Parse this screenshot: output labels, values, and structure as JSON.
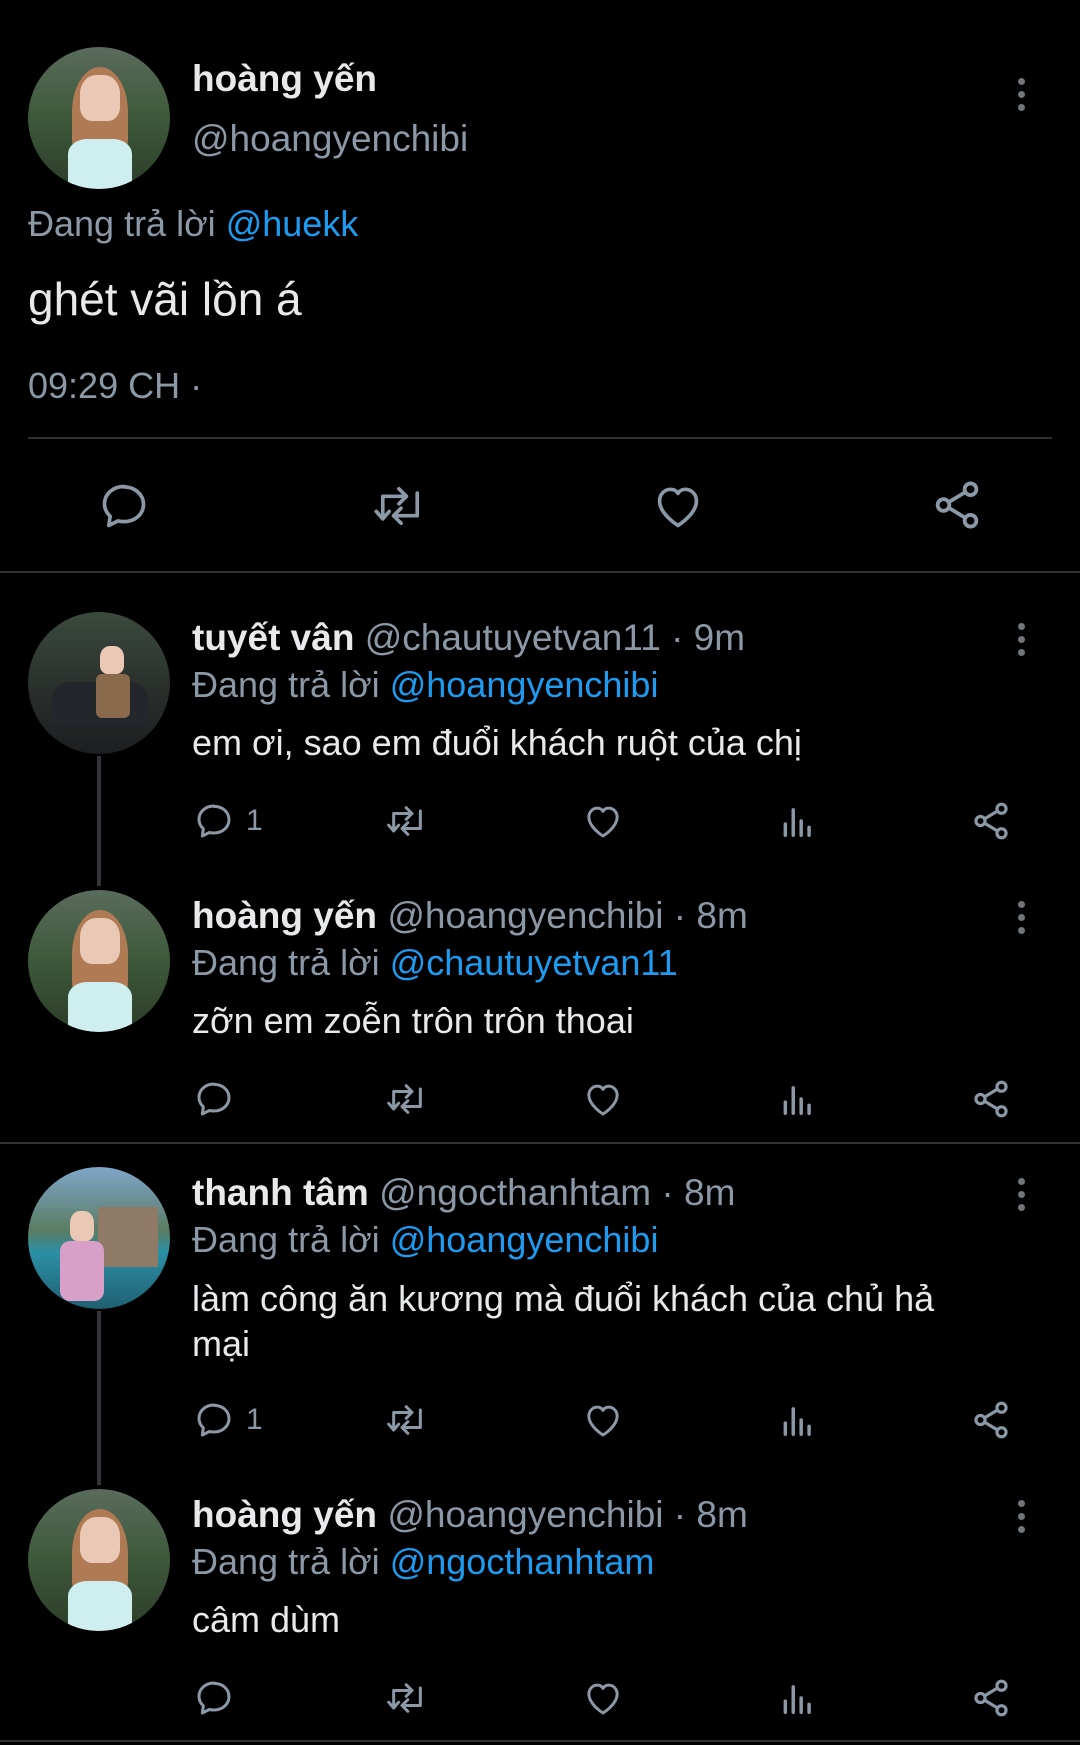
{
  "main_tweet": {
    "display_name": "hoàng yến",
    "handle": "@hoangyenchibi",
    "reply_prefix": "Đang trả lời",
    "reply_to": "@huekk",
    "text": "ghét vãi lồn á",
    "timestamp": "09:29 CH ·"
  },
  "replies": [
    {
      "display_name": "tuyết vân",
      "handle_time": "@chautuyetvan11 · 9m",
      "reply_prefix": "Đang trả lời",
      "reply_to": "@hoangyenchibi",
      "text": "em ơi, sao em đuổi khách ruột của chị",
      "reply_count": "1"
    },
    {
      "display_name": "hoàng yến",
      "handle_time": "@hoangyenchibi · 8m",
      "reply_prefix": "Đang trả lời",
      "reply_to": "@chautuyetvan11",
      "text": "zỡn em zoễn trôn trôn thoai",
      "reply_count": ""
    },
    {
      "display_name": "thanh tâm",
      "handle_time": "@ngocthanhtam · 8m",
      "reply_prefix": "Đang trả lời",
      "reply_to": "@hoangyenchibi",
      "text_line1": "làm công ăn kương mà đuổi khách của chủ hả",
      "text_line2": "mại",
      "reply_count": "1"
    },
    {
      "display_name": "hoàng yến",
      "handle_time": "@hoangyenchibi · 8m",
      "reply_prefix": "Đang trả lời",
      "reply_to": "@ngocthanhtam",
      "text": "câm dùm",
      "reply_count": ""
    }
  ],
  "icons": [
    "reply-icon",
    "retweet-icon",
    "like-icon",
    "views-icon",
    "share-icon",
    "more-icon"
  ],
  "colors": {
    "background": "#000000",
    "text": "#e7e9ea",
    "muted": "#8b98a5",
    "link": "#1d9bf0"
  }
}
